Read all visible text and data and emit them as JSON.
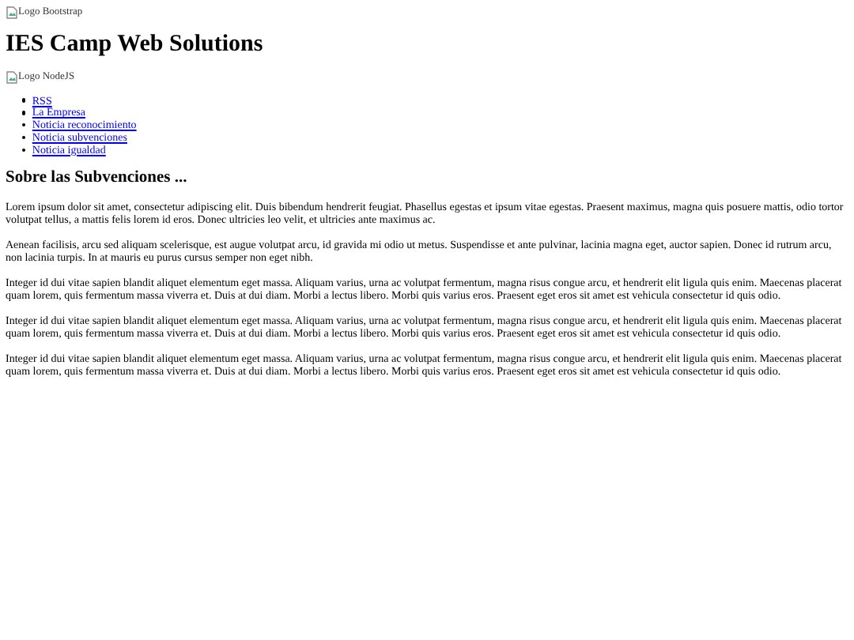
{
  "header_image": {
    "alt": "Logo Bootstrap"
  },
  "title": "IES Camp Web Solutions",
  "secondary_image": {
    "alt": "Logo NodeJS"
  },
  "nav_links": [
    "RSS",
    "La Empresa",
    "Noticia reconocimiento",
    "Noticia subvenciones",
    "Noticia igualdad"
  ],
  "heading": "Sobre las Subvenciones ...",
  "paragraphs": [
    "Lorem ipsum dolor sit amet, consectetur adipiscing elit. Duis bibendum hendrerit feugiat. Phasellus egestas et ipsum vitae egestas. Praesent maximus, magna quis posuere mattis, odio tortor volutpat tellus, a mattis felis lorem id eros. Donec ultricies leo velit, et ultricies ante maximus ac.",
    "Aenean facilisis, arcu sed aliquam scelerisque, est augue volutpat arcu, id gravida mi odio ut metus. Suspendisse et ante pulvinar, lacinia magna eget, auctor sapien. Donec id rutrum arcu, non lacinia turpis. In at mauris eu purus cursus semper non eget nibh.",
    "Integer id dui vitae sapien blandit aliquet elementum eget massa. Aliquam varius, urna ac volutpat fermentum, magna risus congue arcu, et hendrerit elit ligula quis enim. Maecenas placerat quam lorem, quis fermentum massa viverra et. Duis at dui diam. Morbi a lectus libero. Morbi quis varius eros. Praesent eget eros sit amet est vehicula consectetur id quis odio.",
    "Integer id dui vitae sapien blandit aliquet elementum eget massa. Aliquam varius, urna ac volutpat fermentum, magna risus congue arcu, et hendrerit elit ligula quis enim. Maecenas placerat quam lorem, quis fermentum massa viverra et. Duis at dui diam. Morbi a lectus libero. Morbi quis varius eros. Praesent eget eros sit amet est vehicula consectetur id quis odio.",
    "Integer id dui vitae sapien blandit aliquet elementum eget massa. Aliquam varius, urna ac volutpat fermentum, magna risus congue arcu, et hendrerit elit ligula quis enim. Maecenas placerat quam lorem, quis fermentum massa viverra et. Duis at dui diam. Morbi a lectus libero. Morbi quis varius eros. Praesent eget eros sit amet est vehicula consectetur id quis odio."
  ]
}
